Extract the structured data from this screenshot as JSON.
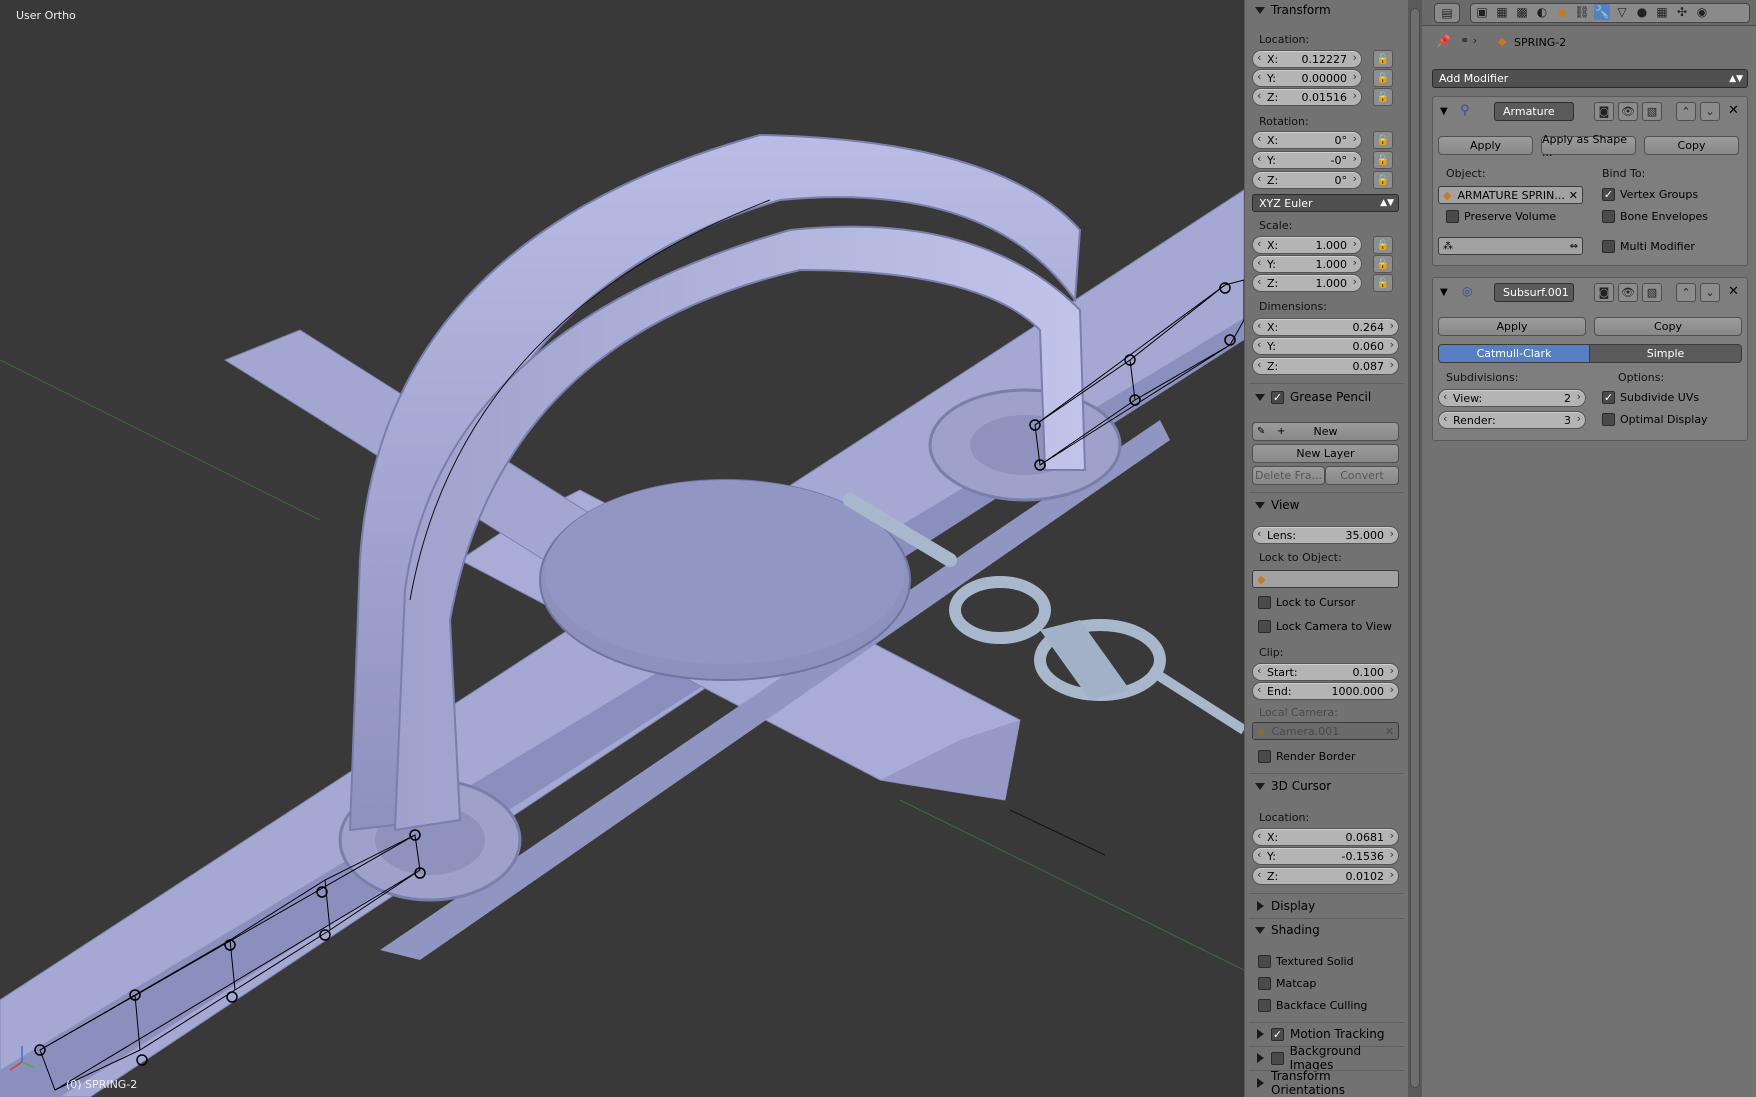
{
  "viewport": {
    "view_label": "User Ortho",
    "object_label": "(0) SPRING-2"
  },
  "npanel": {
    "transform": {
      "title": "Transform",
      "location_label": "Location:",
      "location": [
        {
          "k": "X:",
          "v": "0.12227"
        },
        {
          "k": "Y:",
          "v": "0.00000"
        },
        {
          "k": "Z:",
          "v": "0.01516"
        }
      ],
      "rotation_label": "Rotation:",
      "rotation": [
        {
          "k": "X:",
          "v": "0°"
        },
        {
          "k": "Y:",
          "v": "-0°"
        },
        {
          "k": "Z:",
          "v": "0°"
        }
      ],
      "rotation_mode": "XYZ Euler",
      "scale_label": "Scale:",
      "scale": [
        {
          "k": "X:",
          "v": "1.000"
        },
        {
          "k": "Y:",
          "v": "1.000"
        },
        {
          "k": "Z:",
          "v": "1.000"
        }
      ],
      "dimensions_label": "Dimensions:",
      "dimensions": [
        {
          "k": "X:",
          "v": "0.264"
        },
        {
          "k": "Y:",
          "v": "0.060"
        },
        {
          "k": "Z:",
          "v": "0.087"
        }
      ]
    },
    "grease_pencil": {
      "title": "Grease Pencil",
      "new_label": "New",
      "new_layer_label": "New Layer",
      "delete_frame_label": "Delete Fra...",
      "convert_label": "Convert"
    },
    "view": {
      "title": "View",
      "lens_label": "Lens:",
      "lens_value": "35.000",
      "lock_to_object_label": "Lock to Object:",
      "lock_to_cursor_label": "Lock to Cursor",
      "lock_camera_label": "Lock Camera to View",
      "clip_label": "Clip:",
      "clip_start_label": "Start:",
      "clip_start_value": "0.100",
      "clip_end_label": "End:",
      "clip_end_value": "1000.000",
      "local_camera_label": "Local Camera:",
      "local_camera_value": "Camera.001",
      "render_border_label": "Render Border"
    },
    "cursor": {
      "title": "3D Cursor",
      "location_label": "Location:",
      "location": [
        {
          "k": "X:",
          "v": "0.0681"
        },
        {
          "k": "Y:",
          "v": "-0.1536"
        },
        {
          "k": "Z:",
          "v": "0.0102"
        }
      ]
    },
    "display_title": "Display",
    "shading": {
      "title": "Shading",
      "textured_solid_label": "Textured Solid",
      "matcap_label": "Matcap",
      "backface_label": "Backface Culling"
    },
    "motion_tracking_title": "Motion Tracking",
    "background_images_title": "Background Images",
    "transform_orientations_title": "Transform Orientations"
  },
  "properties": {
    "object_name": "SPRING-2",
    "add_modifier_label": "Add Modifier",
    "armature_mod": {
      "name": "Armature",
      "apply_label": "Apply",
      "apply_shape_label": "Apply as Shape ...",
      "copy_label": "Copy",
      "object_label": "Object:",
      "object_value": "ARMATURE SPRIN...",
      "bind_to_label": "Bind To:",
      "vertex_groups_label": "Vertex Groups",
      "preserve_volume_label": "Preserve Volume",
      "bone_envelopes_label": "Bone Envelopes",
      "multi_modifier_label": "Multi Modifier"
    },
    "subsurf_mod": {
      "name": "Subsurf.001",
      "apply_label": "Apply",
      "copy_label": "Copy",
      "catmull_label": "Catmull-Clark",
      "simple_label": "Simple",
      "subdivisions_label": "Subdivisions:",
      "view_label": "View:",
      "view_value": "2",
      "render_label": "Render:",
      "render_value": "3",
      "options_label": "Options:",
      "subdivide_uvs_label": "Subdivide UVs",
      "optimal_display_label": "Optimal Display"
    }
  },
  "colors": {
    "viewport_bg": "#393939",
    "mesh": "#a9acd4",
    "panel_bg": "#727272",
    "accent_blue": "#5680c2"
  }
}
